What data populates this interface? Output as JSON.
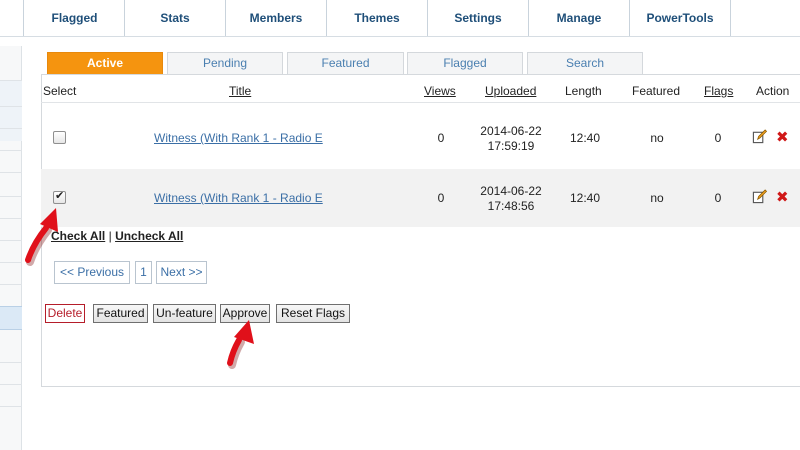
{
  "nav": {
    "items": [
      "Flagged",
      "Stats",
      "Members",
      "Themes",
      "Settings",
      "Manage",
      "PowerTools"
    ]
  },
  "tabs": [
    "Active",
    "Pending",
    "Featured",
    "Flagged",
    "Search"
  ],
  "table": {
    "headers": {
      "select": "Select",
      "title": "Title",
      "views": "Views",
      "uploaded": "Uploaded",
      "length": "Length",
      "featured": "Featured",
      "flags": "Flags",
      "action": "Action"
    },
    "rows": [
      {
        "checked": false,
        "title": "Witness (With Rank 1 - Radio E",
        "views": "0",
        "date": "2014-06-22",
        "time": "17:59:19",
        "length": "12:40",
        "featured": "no",
        "flags": "0"
      },
      {
        "checked": true,
        "title": "Witness (With Rank 1 - Radio E",
        "views": "0",
        "date": "2014-06-22",
        "time": "17:48:56",
        "length": "12:40",
        "featured": "no",
        "flags": "0"
      }
    ]
  },
  "check_links": {
    "check_all": "Check All",
    "separator": "|",
    "uncheck_all": "Uncheck All"
  },
  "pager": {
    "prev": "<< Previous",
    "page": "1",
    "next": "Next >>"
  },
  "actions": {
    "delete": "Delete",
    "featured": "Featured",
    "unfeature": "Un-feature",
    "approve": "Approve",
    "reset_flags": "Reset Flags"
  },
  "colors": {
    "active_tab": "#f5940f",
    "link": "#3b6fa6",
    "nav_text": "#1f4f79",
    "delete_icon": "#d01818",
    "arrow": "#e0101a"
  },
  "icons": {
    "edit": "edit-icon",
    "delete": "delete-icon",
    "arrow": "red-arrow-icon"
  }
}
